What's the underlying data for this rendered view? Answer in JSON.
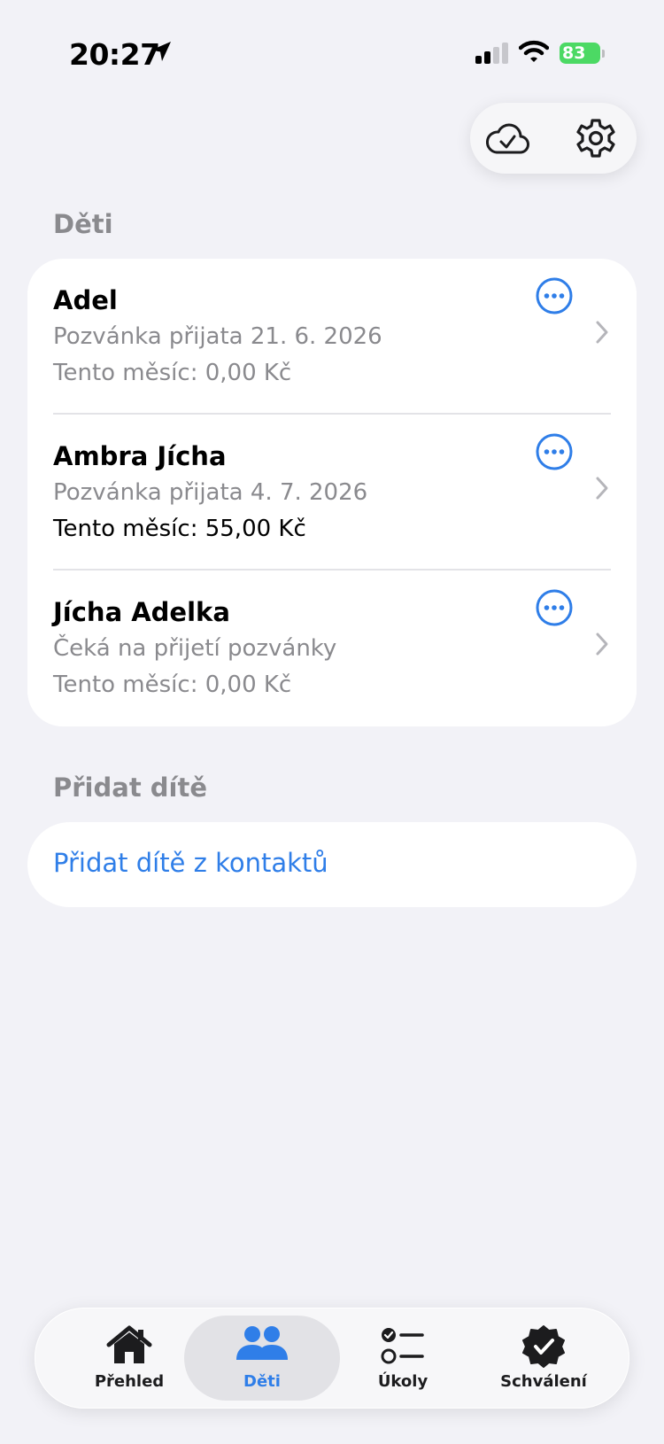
{
  "status_bar": {
    "time": "20:27",
    "battery": "83",
    "location_icon": "location-arrow-icon",
    "signal_icon": "cellular-signal-icon",
    "wifi_icon": "wifi-icon"
  },
  "top_actions": {
    "sync_icon": "cloud-check-icon",
    "settings_icon": "gear-icon"
  },
  "children_section": {
    "header": "Děti",
    "children": [
      {
        "name": "Adel",
        "status": "Pozvánka přijata 21. 6. 2026",
        "month": "Tento měsíc: 0,00 Kč"
      },
      {
        "name": "Ambra Jícha",
        "status": "Pozvánka přijata 4. 7. 2026",
        "month": "Tento měsíc: 55,00 Kč"
      },
      {
        "name": "Jícha Adelka",
        "status": "Čeká na přijetí pozvánky",
        "month": "Tento měsíc: 0,00 Kč"
      }
    ]
  },
  "add_section": {
    "header": "Přidat dítě",
    "link": "Přidat dítě z kontaktů"
  },
  "tab_bar": {
    "tabs": [
      {
        "label": "Přehled",
        "icon": "house-icon"
      },
      {
        "label": "Děti",
        "icon": "people-icon"
      },
      {
        "label": "Úkoly",
        "icon": "checklist-icon"
      },
      {
        "label": "Schválení",
        "icon": "checkmark-seal-icon"
      }
    ],
    "selected": "Děti"
  },
  "colors": {
    "accent": "#2f7ee8",
    "background": "#f2f2f7",
    "secondary_text": "#8a8a8e",
    "battery": "#4cd964"
  }
}
